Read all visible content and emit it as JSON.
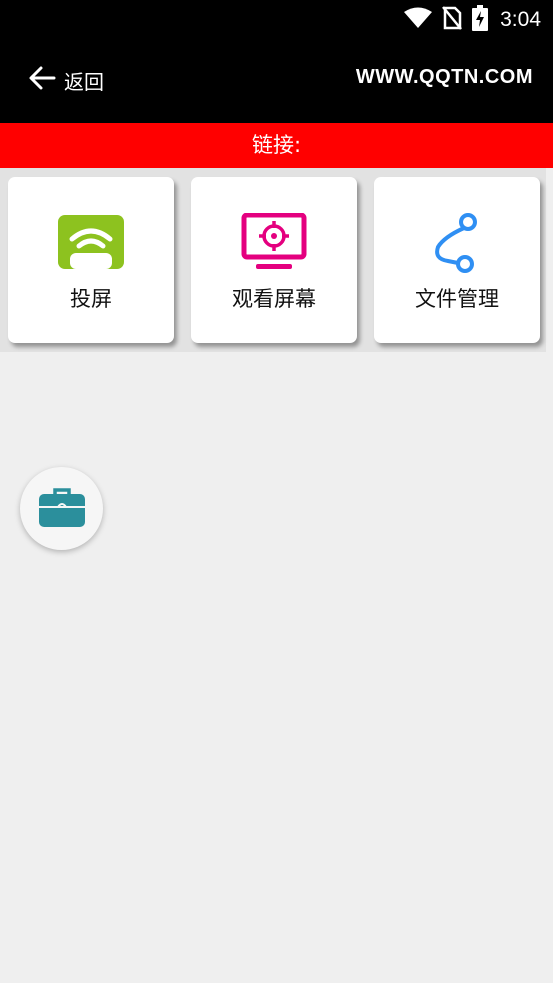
{
  "status_bar": {
    "time": "3:04"
  },
  "header": {
    "back_label": "返回",
    "site": "WWW.QQTN.COM"
  },
  "link_bar": {
    "text": "链接:"
  },
  "cards": [
    {
      "label": "投屏",
      "icon": "cast-screen-icon"
    },
    {
      "label": "观看屏幕",
      "icon": "watch-screen-icon"
    },
    {
      "label": "文件管理",
      "icon": "file-share-icon"
    }
  ],
  "fab": {
    "icon": "toolbox-icon"
  },
  "colors": {
    "link_bar": "#ff0000",
    "cast_icon": "#8dc21f",
    "watch_icon": "#e4007f",
    "file_icon": "#2f8ff3",
    "toolbox": "#2b8f9c"
  }
}
